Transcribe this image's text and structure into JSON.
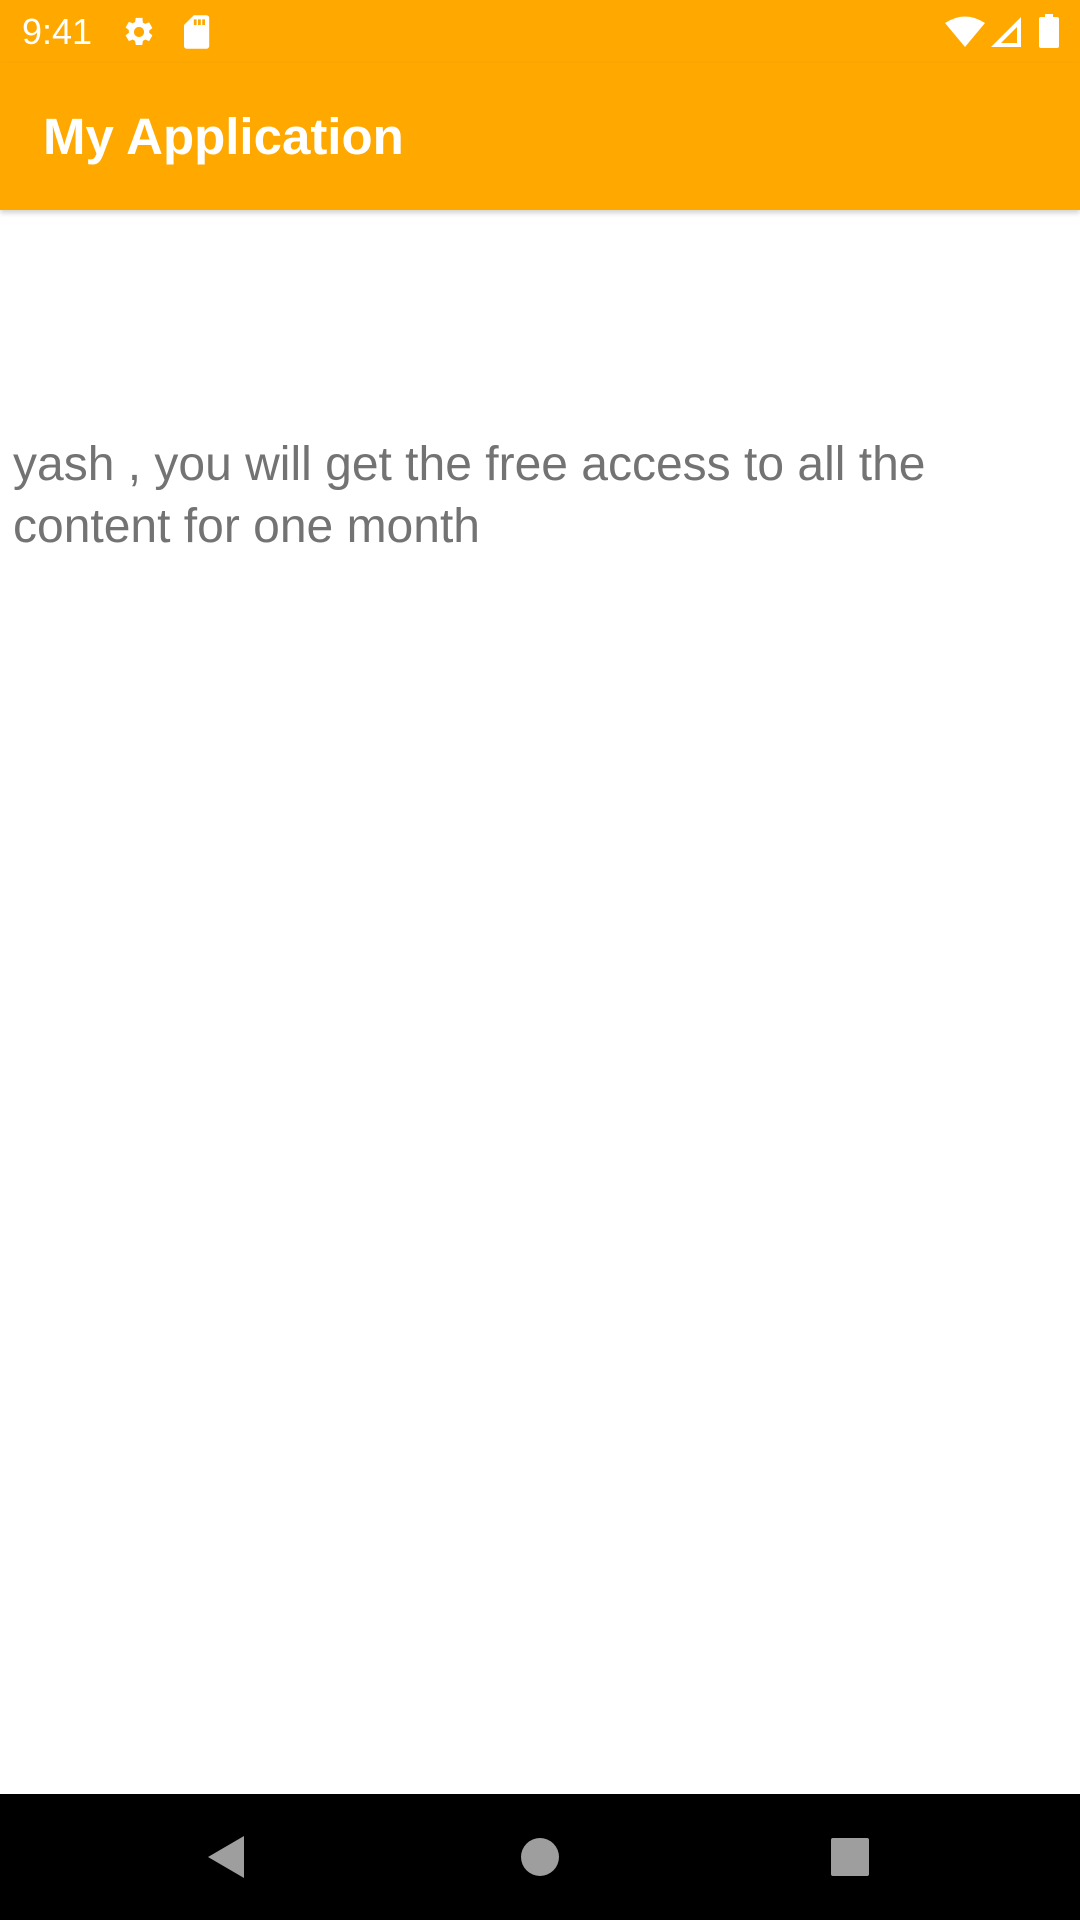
{
  "status_bar": {
    "time": "9:41",
    "background": "#FFA800",
    "left_icons": [
      "gear-icon",
      "sd-card-icon"
    ],
    "right_icons": [
      "wifi-icon",
      "cell-signal-icon",
      "battery-icon"
    ]
  },
  "app_bar": {
    "title": "My Application",
    "background": "#FFA800",
    "title_color": "#FFFFFF"
  },
  "main": {
    "message": "yash , you will get the free access to all the content for one month",
    "text_color": "#737373"
  },
  "nav_bar": {
    "background": "#000000",
    "buttons": [
      "back-icon",
      "home-icon",
      "recents-icon"
    ]
  }
}
